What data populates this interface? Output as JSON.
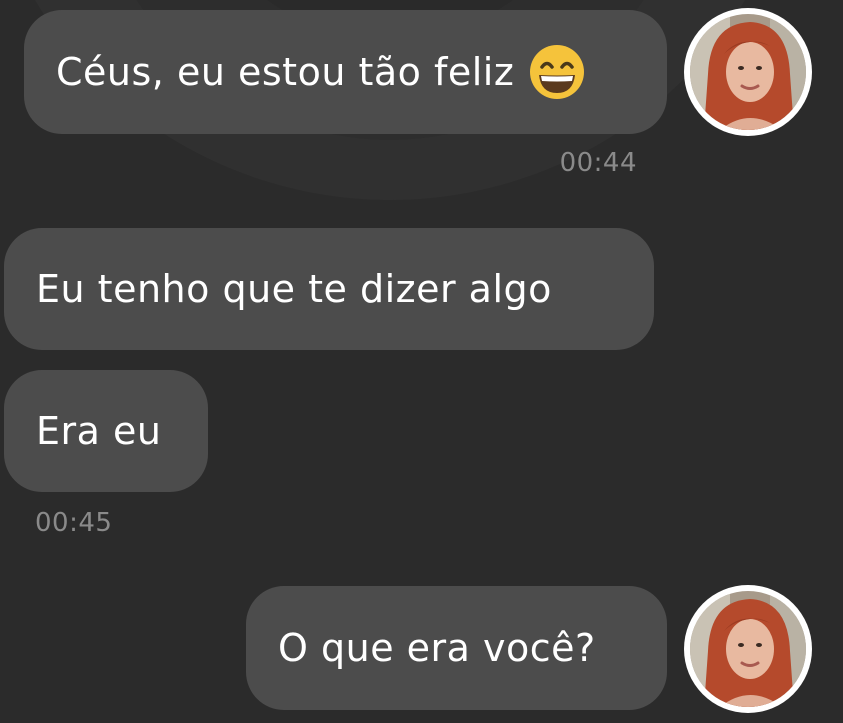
{
  "messages": [
    {
      "text": "Céus, eu estou tão feliz",
      "emoji": "grinning-face-emoji",
      "side": "right",
      "avatar": "sender-avatar"
    },
    {
      "text": "Eu tenho que te dizer algo",
      "side": "left"
    },
    {
      "text": "Era eu",
      "side": "left"
    },
    {
      "text": "O que era você?",
      "side": "right",
      "avatar": "sender-avatar"
    }
  ],
  "timestamps": [
    "00:44",
    "00:45"
  ],
  "colors": {
    "background": "#2b2b2b",
    "bubble": "#4c4c4c",
    "text": "#ffffff",
    "timestamp": "#8a8a8a",
    "emoji": "#f5c33b"
  }
}
